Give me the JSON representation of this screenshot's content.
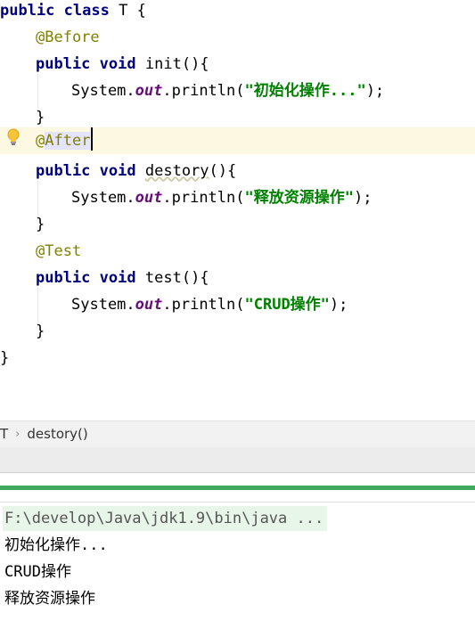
{
  "editor": {
    "lines": {
      "l0": {
        "kw1": "public",
        "kw2": "class",
        "name": "T",
        "brace": "{"
      },
      "l1": {
        "ann": "@Before"
      },
      "l2": {
        "kw1": "public",
        "kw2": "void",
        "name": "init",
        "rest": "(){"
      },
      "l3": {
        "pre": "System.",
        "field": "out",
        "mid": ".println(",
        "str": "\"初始化操作...\"",
        "end": ");"
      },
      "l4": {
        "text": "}"
      },
      "l5": {
        "ann_at": "@",
        "ann": "After"
      },
      "l6": {
        "kw1": "public",
        "kw2": "void",
        "name": "destory",
        "rest": "(){"
      },
      "l7": {
        "pre": "System.",
        "field": "out",
        "mid": ".println(",
        "str": "\"释放资源操作\"",
        "end": ");"
      },
      "l8": {
        "text": "}"
      },
      "l9": {
        "ann": "@Test"
      },
      "l10": {
        "kw1": "public",
        "kw2": "void",
        "name": "test",
        "rest": "(){"
      },
      "l11": {
        "pre": "System.",
        "field": "out",
        "mid": ".println(",
        "str": "\"CRUD操作\"",
        "end": ");"
      },
      "l12": {
        "text": "}"
      },
      "l13": {
        "text": "}"
      }
    }
  },
  "breadcrumb": {
    "class": "T",
    "method": "destory()"
  },
  "run": {
    "progress_percent": 100
  },
  "console": {
    "command": "F:\\develop\\Java\\jdk1.9\\bin\\java ...",
    "output": [
      "初始化操作...",
      "CRUD操作",
      "释放资源操作"
    ]
  },
  "colors": {
    "keyword": "#000080",
    "annotation": "#808000",
    "string": "#008000",
    "field": "#660e7a",
    "progress": "#3fa960"
  }
}
